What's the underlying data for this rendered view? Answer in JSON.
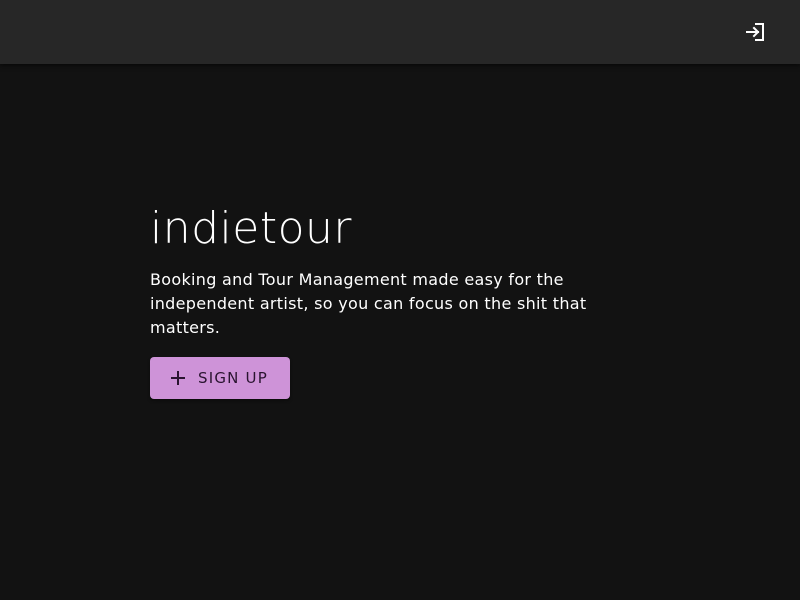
{
  "header": {
    "login_icon": "login-icon",
    "icon_color": "#ffffff",
    "background": "#272727"
  },
  "hero": {
    "title": "indietour",
    "tagline": "Booking and Tour Management made easy for the independent artist, so you can focus on the shit that matters.",
    "signup_label": "Sign up",
    "signup_icon": "plus-icon",
    "accent": "#ce93d8"
  },
  "page": {
    "background": "#121212"
  }
}
